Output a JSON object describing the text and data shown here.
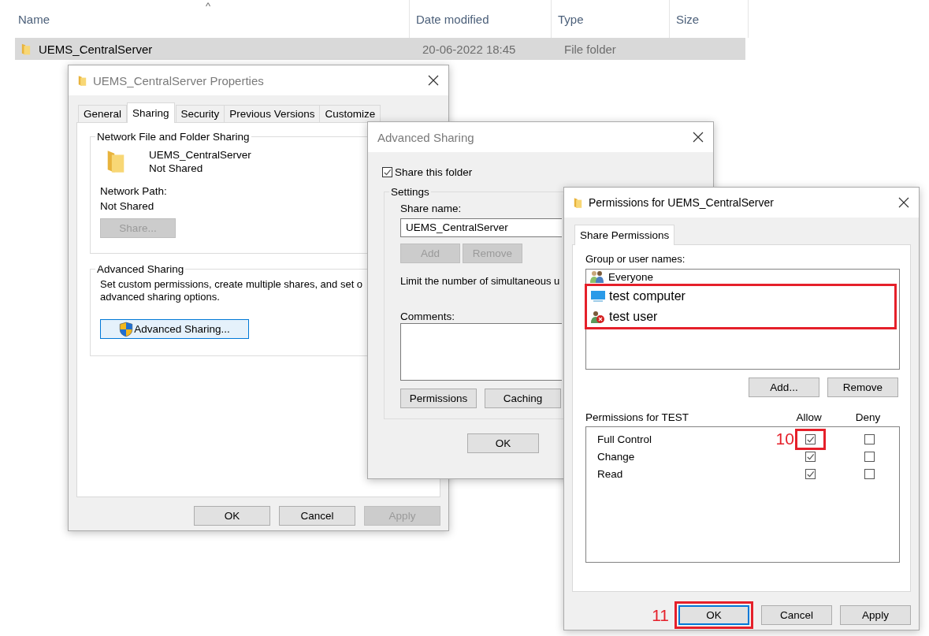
{
  "explorer": {
    "sort_indicator": "^",
    "columns": [
      "Name",
      "Date modified",
      "Type",
      "Size"
    ],
    "rows": [
      {
        "name": "UEMS_CentralServer",
        "date_modified": "20-06-2022 18:45",
        "type": "File folder",
        "selected": true
      }
    ]
  },
  "properties_dialog": {
    "title": "UEMS_CentralServer Properties",
    "tabs": [
      {
        "label": "General",
        "selected": false
      },
      {
        "label": "Sharing",
        "selected": true
      },
      {
        "label": "Security",
        "selected": false
      },
      {
        "label": "Previous Versions",
        "selected": false
      },
      {
        "label": "Customize",
        "selected": false
      }
    ],
    "network_sharing": {
      "heading": "Network File and Folder Sharing",
      "folder_name": "UEMS_CentralServer",
      "status": "Not Shared",
      "path_label": "Network Path:",
      "path_value": "Not Shared",
      "share_button": {
        "label": "Share...",
        "disabled": true
      }
    },
    "advanced_sharing": {
      "heading": "Advanced Sharing",
      "description_lines": [
        "Set custom permissions, create multiple shares, and set o",
        "advanced sharing options."
      ],
      "button": "Advanced Sharing..."
    },
    "buttons": [
      {
        "label": "OK",
        "disabled": false
      },
      {
        "label": "Cancel",
        "disabled": false
      },
      {
        "label": "Apply",
        "disabled": true
      }
    ]
  },
  "advanced_sharing_dialog": {
    "title": "Advanced Sharing",
    "share_this_folder": {
      "label": "Share this folder",
      "checked": true
    },
    "settings": {
      "heading": "Settings",
      "share_name_label": "Share name:",
      "share_name_value": "UEMS_CentralServer",
      "buttons": [
        {
          "label": "Add",
          "disabled": true
        },
        {
          "label": "Remove",
          "disabled": true
        }
      ],
      "limit_text": "Limit the number of simultaneous u",
      "comments_label": "Comments:",
      "action_buttons": [
        {
          "label": "Permissions"
        },
        {
          "label": "Caching"
        }
      ]
    },
    "buttons": [
      {
        "label": "OK"
      }
    ]
  },
  "permissions_dialog": {
    "title": "Permissions for UEMS_CentralServer",
    "tabs": [
      {
        "label": "Share Permissions",
        "selected": true
      }
    ],
    "group_label": "Group or user names:",
    "users": [
      {
        "name": "Everyone",
        "kind": "group",
        "highlighted": false
      },
      {
        "name": "test computer",
        "kind": "computer",
        "highlighted": true
      },
      {
        "name": "test user",
        "kind": "user",
        "highlighted": true
      }
    ],
    "user_buttons": [
      {
        "label": "Add..."
      },
      {
        "label": "Remove"
      }
    ],
    "permissions_label": "Permissions for TEST",
    "columns": [
      "Allow",
      "Deny"
    ],
    "permissions": [
      {
        "name": "Full Control",
        "allow": true,
        "deny": false,
        "callout": "10"
      },
      {
        "name": "Change",
        "allow": true,
        "deny": false
      },
      {
        "name": "Read",
        "allow": true,
        "deny": false
      }
    ],
    "buttons": [
      {
        "label": "OK",
        "focused": true,
        "callout": "11"
      },
      {
        "label": "Cancel",
        "focused": false
      },
      {
        "label": "Apply",
        "focused": false
      }
    ]
  }
}
